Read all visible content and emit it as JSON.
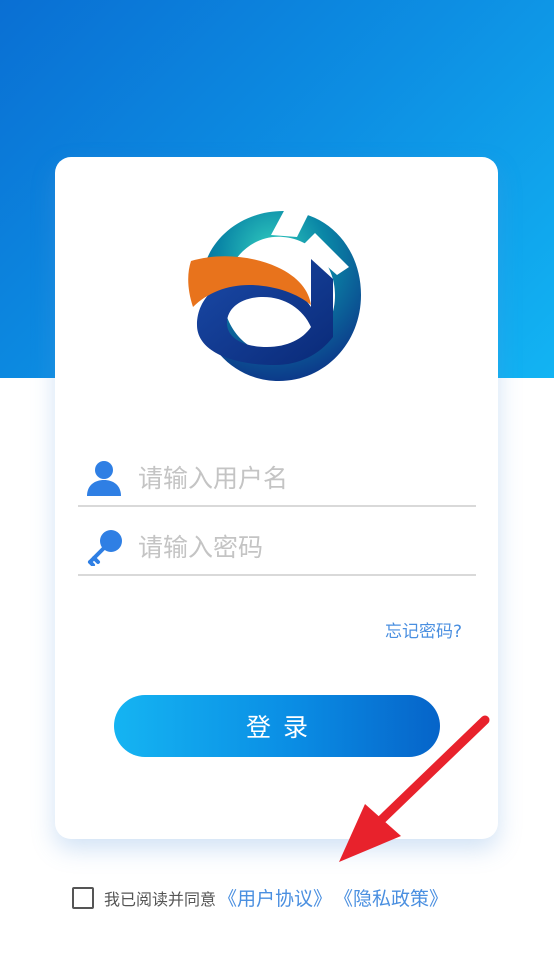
{
  "colors": {
    "header_gradient_start": "#0a6fd3",
    "header_gradient_end": "#12b4f3",
    "accent_blue": "#4a8fe0",
    "button_gradient_start": "#15b4f2",
    "button_gradient_end": "#0664c9",
    "arrow_red": "#e8222c"
  },
  "icons": {
    "logo": "company-logo",
    "username": "user-icon",
    "password": "key-icon",
    "checkbox": "checkbox-unchecked"
  },
  "login": {
    "username_placeholder": "请输入用户名",
    "password_placeholder": "请输入密码",
    "forgot_password": "忘记密码?",
    "submit_label": "登录"
  },
  "agreement": {
    "prefix": "我已阅读并同意",
    "user_agreement": "《用户协议》",
    "privacy_policy": "《隐私政策》"
  }
}
